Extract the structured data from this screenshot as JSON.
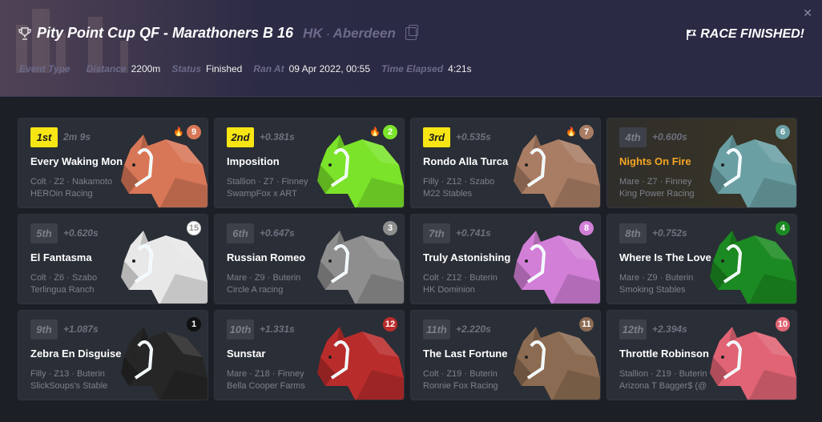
{
  "header": {
    "title": "Pity Point Cup QF - Marathoners B 16",
    "region": "HK",
    "separator": "·",
    "city": "Aberdeen",
    "status_banner": "RACE FINISHED!",
    "close": "✕",
    "meta": [
      {
        "key": "Event Type",
        "value": ""
      },
      {
        "key": "Distance",
        "value": "2200m"
      },
      {
        "key": "Status",
        "value": "Finished"
      },
      {
        "key": "Ran At",
        "value": "09 Apr 2022, 00:55"
      },
      {
        "key": "Time Elapsed",
        "value": "4:21s"
      }
    ]
  },
  "results": [
    {
      "place": "1st",
      "gap": "2m 9s",
      "name": "Every Waking Mon",
      "details": "Colt · Z2 · Nakamoto",
      "stable": "HEROin Racing",
      "number": "9",
      "fire": true,
      "color": "#d87757",
      "num_color": "#d87757",
      "num_text": "#fff",
      "top": true
    },
    {
      "place": "2nd",
      "gap": "+0.381s",
      "name": "Imposition",
      "details": "Stallion · Z7 · Finney",
      "stable": "SwampFox x ART",
      "number": "2",
      "fire": true,
      "color": "#7be42a",
      "num_color": "#7be42a",
      "num_text": "#fff",
      "top": true
    },
    {
      "place": "3rd",
      "gap": "+0.535s",
      "name": "Rondo Alla Turca",
      "details": "Filly · Z12 · Szabo",
      "stable": "M22 Stables",
      "number": "7",
      "fire": true,
      "color": "#a97d64",
      "num_color": "#a97d64",
      "num_text": "#fff",
      "top": true
    },
    {
      "place": "4th",
      "gap": "+0.600s",
      "name": "Nights On Fire",
      "details": "Mare · Z7 · Finney",
      "stable": "King Power Racing",
      "number": "6",
      "fire": false,
      "color": "#6a9fa3",
      "num_color": "#6a9fa3",
      "num_text": "#fff",
      "top": false,
      "gold": true
    },
    {
      "place": "5th",
      "gap": "+0.620s",
      "name": "El Fantasma",
      "details": "Colt · Z6 · Szabo",
      "stable": "Terlingua Ranch",
      "number": "15",
      "fire": false,
      "color": "#e8e8e8",
      "num_color": "#ffffff",
      "num_text": "#999",
      "top": false
    },
    {
      "place": "6th",
      "gap": "+0.647s",
      "name": "Russian Romeo",
      "details": "Mare · Z9 · Buterin",
      "stable": "Circle A racing",
      "number": "3",
      "fire": false,
      "color": "#8e8e8e",
      "num_color": "#8e8e8e",
      "num_text": "#fff",
      "top": false
    },
    {
      "place": "7th",
      "gap": "+0.741s",
      "name": "Truly Astonishing",
      "details": "Colt · Z12 · Buterin",
      "stable": "HK Dominion",
      "number": "8",
      "fire": false,
      "color": "#d27fd7",
      "num_color": "#d27fd7",
      "num_text": "#fff",
      "top": false
    },
    {
      "place": "8th",
      "gap": "+0.752s",
      "name": "Where Is The Love",
      "details": "Mare · Z9 · Buterin",
      "stable": "Smoking Stables",
      "number": "4",
      "fire": false,
      "color": "#1c8a22",
      "num_color": "#1c8a22",
      "num_text": "#fff",
      "top": false
    },
    {
      "place": "9th",
      "gap": "+1.087s",
      "name": "Zebra En Disguise",
      "details": "Filly · Z13 · Buterin",
      "stable": "SlickSoups's Stable",
      "number": "1",
      "fire": false,
      "color": "#262626",
      "num_color": "#111111",
      "num_text": "#fff",
      "top": false
    },
    {
      "place": "10th",
      "gap": "+1.331s",
      "name": "Sunstar",
      "details": "Mare · Z18 · Finney",
      "stable": "Bella Cooper Farms",
      "number": "12",
      "fire": false,
      "color": "#b92c2c",
      "num_color": "#b92c2c",
      "num_text": "#fff",
      "top": false
    },
    {
      "place": "11th",
      "gap": "+2.220s",
      "name": "The Last Fortune",
      "details": "Colt · Z19 · Buterin",
      "stable": "Ronnie Fox Racing",
      "number": "11",
      "fire": false,
      "color": "#8b6b52",
      "num_color": "#8b6b52",
      "num_text": "#fff",
      "top": false
    },
    {
      "place": "12th",
      "gap": "+2.394s",
      "name": "Throttle Robinson",
      "details": "Stallion · Z19 · Buterin",
      "stable": "Arizona T Bagger$ (@",
      "number": "10",
      "fire": false,
      "color": "#e06474",
      "num_color": "#e06474",
      "num_text": "#fff",
      "top": false
    }
  ]
}
